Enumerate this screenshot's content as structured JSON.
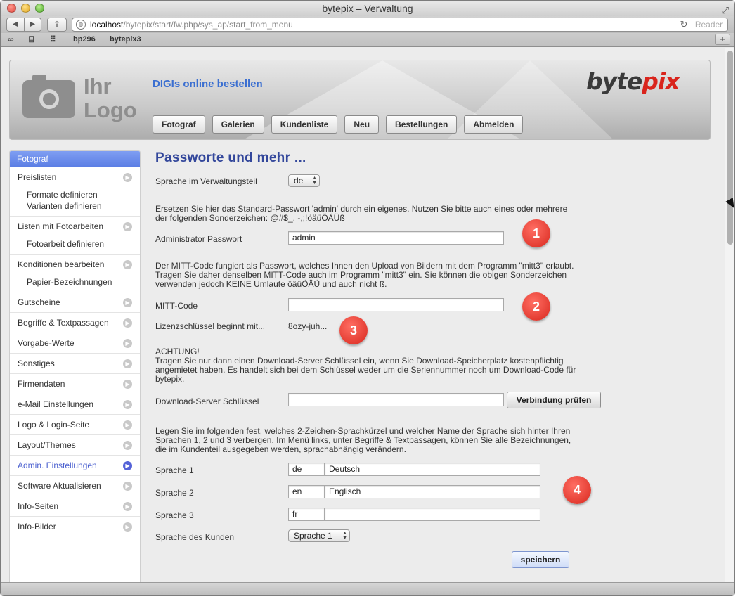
{
  "window": {
    "title": "bytepix – Verwaltung"
  },
  "browser": {
    "url_host": "localhost",
    "url_path": "/bytepix/start/fw.php/sys_ap/start_from_menu",
    "reader_label": "Reader",
    "bookmarks": [
      "bp296",
      "bytepix3"
    ]
  },
  "header": {
    "logo_line1": "Ihr",
    "logo_line2": "Logo",
    "tagline": "DIGIs online bestellen",
    "brand_main": "byte",
    "brand_accent": "pix",
    "nav": [
      "Fotograf",
      "Galerien",
      "Kundenliste",
      "Neu",
      "Bestellungen",
      "Abmelden"
    ]
  },
  "sidebar": {
    "title": "Fotograf",
    "items": [
      {
        "label": "Preislisten",
        "subs": [
          "Formate definieren",
          "Varianten definieren"
        ]
      },
      {
        "label": "Listen mit Fotoarbeiten",
        "subs": [
          "Fotoarbeit definieren"
        ]
      },
      {
        "label": "Konditionen bearbeiten",
        "subs": [
          "Papier-Bezeichnungen"
        ]
      },
      {
        "label": "Gutscheine"
      },
      {
        "label": "Begriffe & Textpassagen"
      },
      {
        "label": "Vorgabe-Werte"
      },
      {
        "label": "Sonstiges"
      },
      {
        "label": "Firmendaten"
      },
      {
        "label": "e-Mail Einstellungen"
      },
      {
        "label": "Logo & Login-Seite"
      },
      {
        "label": "Layout/Themes"
      },
      {
        "label": "Admin. Einstellungen"
      },
      {
        "label": "Software Aktualisieren"
      },
      {
        "label": "Info-Seiten"
      },
      {
        "label": "Info-Bilder"
      }
    ]
  },
  "main": {
    "title": "Passworte und mehr ...",
    "language_admin_label": "Sprache im Verwaltungsteil",
    "language_admin_value": "de",
    "password_intro": "Ersetzen Sie hier das Standard-Passwort 'admin' durch ein eigenes. Nutzen Sie bitte auch eines oder mehrere der folgenden Sonderzeichen: @#$_. -,;!öäüÖÄÜß",
    "admin_password_label": "Administrator Passwort",
    "admin_password_value": "admin",
    "mitt_intro": "Der MITT-Code fungiert als Passwort, welches Ihnen den Upload von Bildern mit dem Programm \"mitt3\" erlaubt. Tragen Sie daher denselben MITT-Code auch im Programm \"mitt3\" ein. Sie können die obigen Sonderzeichen verwenden jedoch KEINE Umlaute öäüÖÄÜ und auch nicht ß.",
    "mitt_label": "MITT-Code",
    "mitt_value": "",
    "license_label": "Lizenzschlüssel beginnt mit...",
    "license_value": "8ozy-juh...",
    "download_warning_title": "ACHTUNG!",
    "download_warning": "Tragen Sie nur dann einen Download-Server Schlüssel ein, wenn Sie Download-Speicherplatz kostenpflichtig angemietet haben. Es handelt sich bei dem Schlüssel weder um die Seriennummer noch um Download-Code für bytepix.",
    "download_key_label": "Download-Server Schlüssel",
    "download_key_value": "",
    "check_connection_label": "Verbindung prüfen",
    "languages_intro": "Legen Sie im folgenden fest, welches 2-Zeichen-Sprachkürzel und welcher Name der Sprache sich hinter Ihren Sprachen 1, 2 und 3 verbergen. Im Menü links, unter Begriffe & Textpassagen, können Sie alle Bezeichnungen, die im Kundenteil ausgegeben werden, sprachabhängig verändern.",
    "languages": [
      {
        "label": "Sprache 1",
        "code": "de",
        "name": "Deutsch"
      },
      {
        "label": "Sprache 2",
        "code": "en",
        "name": "Englisch"
      },
      {
        "label": "Sprache 3",
        "code": "fr",
        "name": ""
      }
    ],
    "customer_language_label": "Sprache des Kunden",
    "customer_language_value": "Sprache 1",
    "save_label": "speichern",
    "badges": [
      "1",
      "2",
      "3",
      "4"
    ]
  }
}
